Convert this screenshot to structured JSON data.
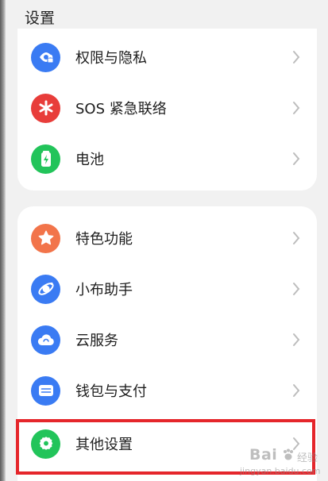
{
  "header": {
    "title": "设置"
  },
  "section_1": {
    "items": [
      {
        "label": "权限与隐私",
        "icon": "privacy-shield-icon",
        "color": "#3a7bf3"
      },
      {
        "label": "SOS 紧急联络",
        "icon": "sos-asterisk-icon",
        "color": "#e83d3a"
      },
      {
        "label": "电池",
        "icon": "battery-icon",
        "color": "#22c45a"
      }
    ]
  },
  "section_2": {
    "items": [
      {
        "label": "特色功能",
        "icon": "star-icon",
        "color": "#f2744a"
      },
      {
        "label": "小布助手",
        "icon": "assistant-icon",
        "color": "#3a7bf3"
      },
      {
        "label": "云服务",
        "icon": "cloud-icon",
        "color": "#3a7bf3"
      },
      {
        "label": "钱包与支付",
        "icon": "wallet-icon",
        "color": "#3a7bf3"
      },
      {
        "label": "其他设置",
        "icon": "gear-icon",
        "color": "#22c45a"
      }
    ]
  },
  "overlay": {
    "highlight_color": "#e5262b",
    "play_icon": "play-icon"
  },
  "watermark": {
    "brand": "Bai",
    "brand_suffix": "经验",
    "domain": "jingyan.baidu.com"
  },
  "colors": {
    "background": "#f1f1f1",
    "card": "#ffffff",
    "chevron": "#bdbdbd"
  }
}
